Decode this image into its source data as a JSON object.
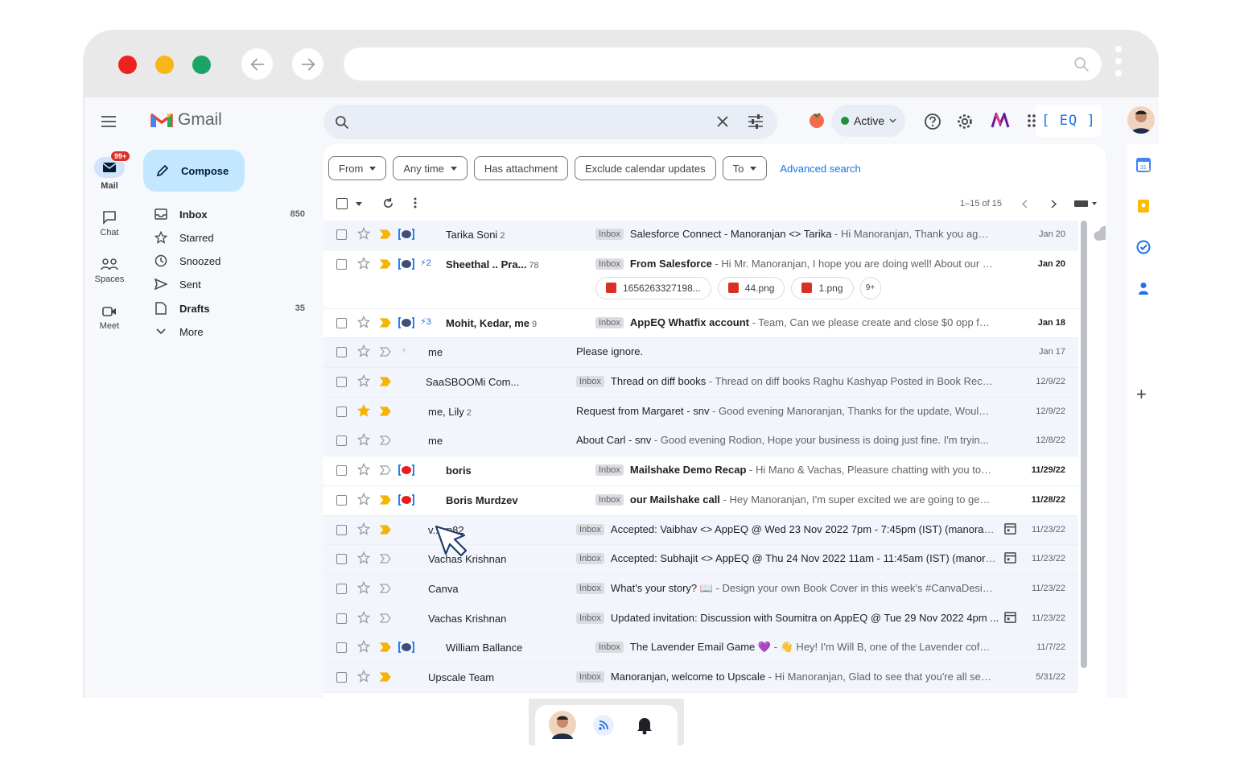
{
  "app": {
    "name": "Gmail"
  },
  "rail": {
    "mail_label": "Mail",
    "mail_badge": "99+",
    "chat_label": "Chat",
    "spaces_label": "Spaces",
    "meet_label": "Meet"
  },
  "compose_label": "Compose",
  "nav": [
    {
      "label": "Inbox",
      "count": "850",
      "icon": "inbox-icon"
    },
    {
      "label": "Starred",
      "count": "",
      "icon": "star-icon"
    },
    {
      "label": "Snoozed",
      "count": "",
      "icon": "clock-icon"
    },
    {
      "label": "Sent",
      "count": "",
      "icon": "send-icon"
    },
    {
      "label": "Drafts",
      "count": "35",
      "icon": "draft-icon"
    },
    {
      "label": "More",
      "count": "",
      "icon": "chevron-down-icon"
    }
  ],
  "header": {
    "status_label": "Active",
    "status_color": "#1e8e3e",
    "extension_logo": "[ EQ ]"
  },
  "filters": {
    "from": "From",
    "any_time": "Any time",
    "has_attachment": "Has attachment",
    "exclude_calendar": "Exclude calendar updates",
    "to": "To",
    "advanced": "Advanced search"
  },
  "pager": "1–15 of 15",
  "emails": [
    {
      "sender": "Tarika Soni",
      "count": "2",
      "tag": "Inbox",
      "subject": "Salesforce Connect - Manoranjan <> Tarika",
      "snippet": " - Hi Manoranjan, Thank you again...",
      "date": "Jan 20"
    },
    {
      "sender": "Sheethal .. Pra...",
      "count": "78",
      "tag": "Inbox",
      "subject": "From Salesforce",
      "snippet": " - Hi Mr. Manoranjan, I hope you are doing well! About our c...",
      "date": "Jan 20",
      "bolt": "2"
    },
    {
      "sender": "Mohit, Kedar, me",
      "count": "9",
      "tag": "Inbox",
      "subject": "AppEQ Whatfix account",
      "snippet": " - Team, Can we please create and close $0 opp fo...",
      "date": "Jan 18",
      "bolt": "3"
    },
    {
      "sender": "me",
      "count": "",
      "tag": "",
      "subject": "Please ignore.",
      "snippet": "",
      "date": "Jan 17"
    },
    {
      "sender": "SaaSBOOMi Com...",
      "count": "",
      "tag": "Inbox",
      "subject": "Thread on diff books",
      "snippet": " - Thread on diff books Raghu Kashyap Posted in Book Reco...",
      "date": "12/9/22"
    },
    {
      "sender": "me, Lily",
      "count": "2",
      "tag": "",
      "subject": "Request from Margaret - snv",
      "snippet": " - Good evening Manoranjan, Thanks for the update, Would...",
      "date": "12/9/22"
    },
    {
      "sender": "me",
      "count": "",
      "tag": "",
      "subject": "About Carl - snv",
      "snippet": " - Good evening Rodion, Hope your business is doing just fine. I'm tryin...",
      "date": "12/8/22"
    },
    {
      "sender": "boris",
      "count": "",
      "tag": "Inbox",
      "subject": "Mailshake Demo Recap",
      "snippet": " - Hi Mano & Vachas, Pleasure chatting with you tod...",
      "date": "11/29/22"
    },
    {
      "sender": "Boris Murdzev",
      "count": "",
      "tag": "Inbox",
      "subject": "our Mailshake call",
      "snippet": " - Hey Manoranjan, I'm super excited we are going to get ...",
      "date": "11/28/22"
    },
    {
      "sender": "v...vp82",
      "count": "",
      "tag": "Inbox",
      "subject": "Accepted: Vaibhav <> AppEQ @ Wed 23 Nov 2022 7pm - 7:45pm (IST) (manoranja...",
      "snippet": "",
      "date": "11/23/22"
    },
    {
      "sender": "Vachas Krishnan",
      "count": "",
      "tag": "Inbox",
      "subject": "Accepted: Subhajit <> AppEQ @ Thu 24 Nov 2022 11am - 11:45am (IST) (manoranj...",
      "snippet": "",
      "date": "11/23/22"
    },
    {
      "sender": "Canva",
      "count": "",
      "tag": "Inbox",
      "subject": "What's your story? 📖",
      "snippet": " - Design your own Book Cover in this week's #CanvaDesig...",
      "date": "11/23/22"
    },
    {
      "sender": "Vachas Krishnan",
      "count": "",
      "tag": "Inbox",
      "subject": "Updated invitation: Discussion with Soumitra on AppEQ @ Tue 29 Nov 2022 4pm ...",
      "snippet": "",
      "date": "11/23/22"
    },
    {
      "sender": "William Ballance",
      "count": "",
      "tag": "Inbox",
      "subject": "The Lavender Email Game 💜",
      "snippet": " - 👋 Hey! I'm Will B, one of the Lavender cofou...",
      "date": "11/7/22"
    },
    {
      "sender": "Upscale Team",
      "count": "",
      "tag": "Inbox",
      "subject": "Manoranjan, welcome to Upscale",
      "snippet": " - Hi Manoranjan, Glad to see that you're all set ...",
      "date": "5/31/22"
    }
  ],
  "attachments": [
    "1656263327198...",
    "44.png",
    "1.png",
    "9+"
  ]
}
